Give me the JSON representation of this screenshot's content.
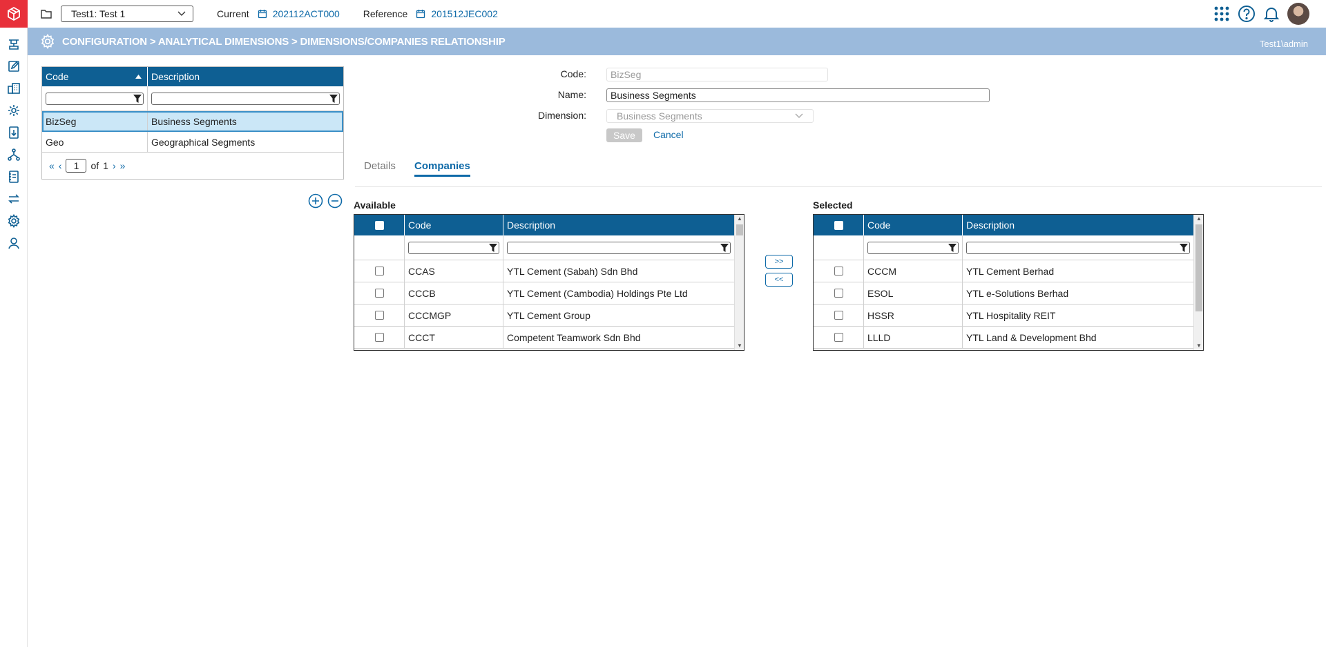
{
  "header": {
    "company": "Test1: Test 1",
    "current_label": "Current",
    "current_value": "202112ACT000",
    "reference_label": "Reference",
    "reference_value": "201512JEC002"
  },
  "band": {
    "title": "CONFIGURATION > ANALYTICAL DIMENSIONS > DIMENSIONS/COMPANIES RELATIONSHIP",
    "user": "Test1\\admin"
  },
  "list": {
    "columns": [
      "Code",
      "Description"
    ],
    "rows": [
      {
        "code": "BizSeg",
        "description": "Business Segments"
      },
      {
        "code": "Geo",
        "description": "Geographical Segments"
      }
    ],
    "page": "1",
    "of_label": "of",
    "total_pages": "1"
  },
  "form": {
    "code_label": "Code:",
    "code_value": "BizSeg",
    "name_label": "Name:",
    "name_value": "Business Segments",
    "dimension_label": "Dimension:",
    "dimension_value": "Business Segments",
    "save_label": "Save",
    "cancel_label": "Cancel"
  },
  "tabs": {
    "details": "Details",
    "companies": "Companies"
  },
  "available": {
    "title": "Available",
    "columns": [
      "Code",
      "Description"
    ],
    "rows": [
      {
        "code": "CCAS",
        "description": "YTL Cement (Sabah) Sdn Bhd"
      },
      {
        "code": "CCCB",
        "description": "YTL Cement (Cambodia) Holdings Pte Ltd"
      },
      {
        "code": "CCCMGP",
        "description": "YTL Cement Group"
      },
      {
        "code": "CCCT",
        "description": "Competent Teamwork Sdn Bhd"
      }
    ]
  },
  "selected": {
    "title": "Selected",
    "columns": [
      "Code",
      "Description"
    ],
    "rows": [
      {
        "code": "CCCM",
        "description": "YTL Cement Berhad"
      },
      {
        "code": "ESOL",
        "description": "YTL e-Solutions Berhad"
      },
      {
        "code": "HSSR",
        "description": "YTL Hospitality REIT"
      },
      {
        "code": "LLLD",
        "description": "YTL Land & Development Bhd"
      }
    ]
  },
  "move": {
    "add_label": ">>",
    "remove_label": "<<"
  },
  "colors": {
    "accent": "#0e5f93",
    "band": "#9bbadc",
    "logo": "#e8303a",
    "link": "#0e6aa8"
  }
}
